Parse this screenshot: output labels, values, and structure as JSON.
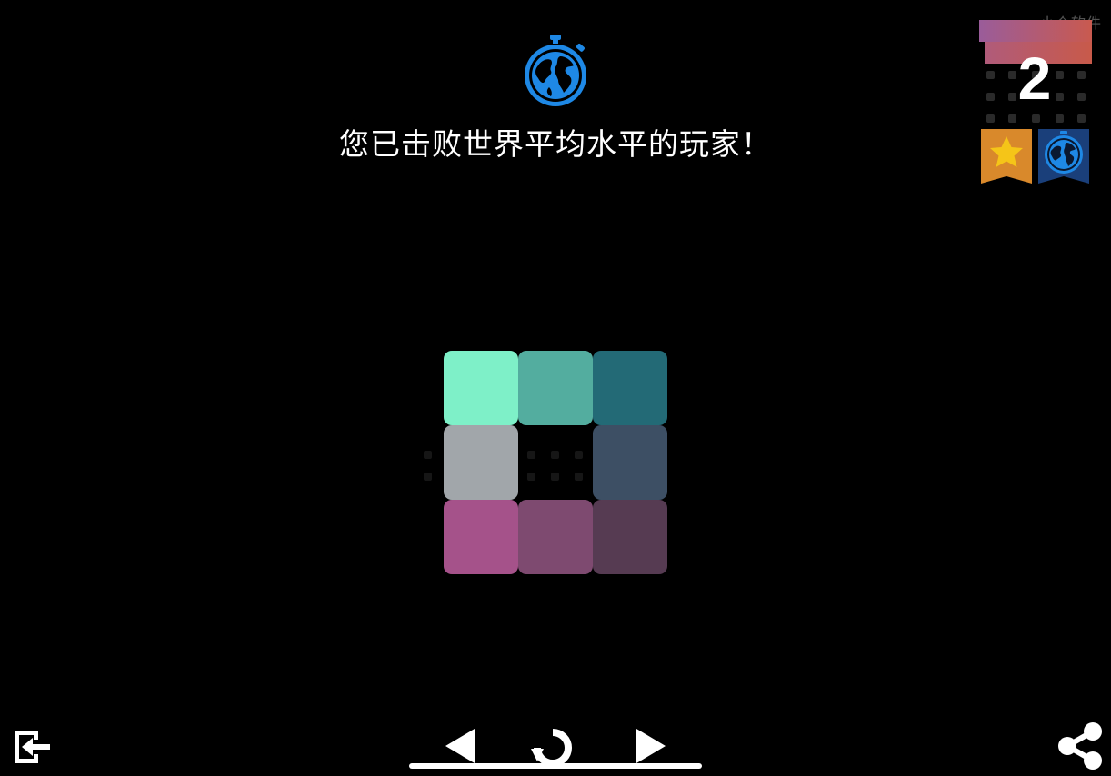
{
  "watermark": "小众软件",
  "result": {
    "message": "您已击败世界平均水平的玩家！",
    "icon": "stopwatch-globe-icon",
    "icon_color": "#1e88e5"
  },
  "level": {
    "number": "2",
    "badges": [
      {
        "name": "star-ribbon",
        "icon": "star-icon",
        "color": "#d9892b",
        "star_color": "#f5c518"
      },
      {
        "name": "globe-ribbon",
        "icon": "stopwatch-globe-icon",
        "color": "#1a3f7a"
      }
    ]
  },
  "board": {
    "rows": 3,
    "cols": 3,
    "tiles": [
      {
        "row": 0,
        "col": 0,
        "color": "#7ef0c8"
      },
      {
        "row": 0,
        "col": 1,
        "color": "#53ad9f"
      },
      {
        "row": 0,
        "col": 2,
        "color": "#236a76"
      },
      {
        "row": 1,
        "col": 0,
        "color": "#a1a6aa"
      },
      {
        "row": 1,
        "col": 2,
        "color": "#3d4f64"
      },
      {
        "row": 2,
        "col": 0,
        "color": "#a5528a"
      },
      {
        "row": 2,
        "col": 1,
        "color": "#7e4a70"
      },
      {
        "row": 2,
        "col": 2,
        "color": "#563b52"
      }
    ]
  },
  "controls": {
    "exit_icon": "exit-icon",
    "prev_icon": "triangle-left-icon",
    "restart_icon": "restart-icon",
    "next_icon": "triangle-right-icon",
    "share_icon": "share-icon"
  }
}
